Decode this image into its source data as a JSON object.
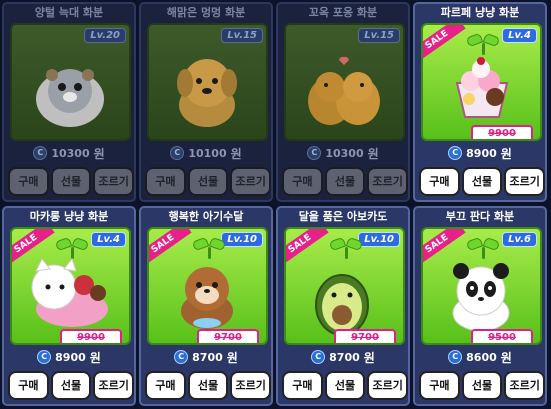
{
  "colors": {
    "accent": "#2f6be0",
    "sale": "#e8208a",
    "scene_green": "#58c01a",
    "card_bg": "#2b3766"
  },
  "shop": {
    "cards": [
      {
        "title": "양털 늑대 화분",
        "level": "Lv.20",
        "price": "10300",
        "currency": "원",
        "owned": true,
        "sale": false,
        "buttons": [
          "구매",
          "선물",
          "조르기"
        ],
        "icon": "sheep-wolf-icon"
      },
      {
        "title": "해맑은 멍멍 화분",
        "level": "Lv.15",
        "price": "10100",
        "currency": "원",
        "owned": true,
        "sale": false,
        "buttons": [
          "구매",
          "선물",
          "조르기"
        ],
        "icon": "puppy-icon"
      },
      {
        "title": "꼬옥 포옹 화분",
        "level": "Lv.15",
        "price": "10300",
        "currency": "원",
        "owned": true,
        "sale": false,
        "buttons": [
          "구매",
          "선물",
          "조르기"
        ],
        "icon": "hug-dogs-icon"
      },
      {
        "title": "파르페 냥냥 화분",
        "level": "Lv.4",
        "price": "8900",
        "old_price": "9900",
        "currency": "원",
        "owned": false,
        "sale": true,
        "sale_label": "SALE",
        "buttons": [
          "구매",
          "선물",
          "조르기"
        ],
        "icon": "parfait-icon"
      },
      {
        "title": "마카롱 냥냥 화분",
        "level": "Lv.4",
        "price": "8900",
        "old_price": "9900",
        "currency": "원",
        "owned": false,
        "sale": true,
        "sale_label": "SALE",
        "buttons": [
          "구매",
          "선물",
          "조르기"
        ],
        "icon": "macaron-cat-icon"
      },
      {
        "title": "행복한 아기수달",
        "level": "Lv.10",
        "price": "8700",
        "old_price": "9700",
        "currency": "원",
        "owned": false,
        "sale": true,
        "sale_label": "SALE",
        "buttons": [
          "구매",
          "선물",
          "조르기"
        ],
        "icon": "otter-icon"
      },
      {
        "title": "달을 품은 아보카도",
        "level": "Lv.10",
        "price": "8700",
        "old_price": "9700",
        "currency": "원",
        "owned": false,
        "sale": true,
        "sale_label": "SALE",
        "buttons": [
          "구매",
          "선물",
          "조르기"
        ],
        "icon": "avocado-icon"
      },
      {
        "title": "부끄 판다 화분",
        "level": "Lv.6",
        "price": "8600",
        "old_price": "9500",
        "currency": "원",
        "owned": false,
        "sale": true,
        "sale_label": "SALE",
        "buttons": [
          "구매",
          "선물",
          "조르기"
        ],
        "icon": "panda-icon"
      }
    ]
  },
  "coin_symbol": "C"
}
